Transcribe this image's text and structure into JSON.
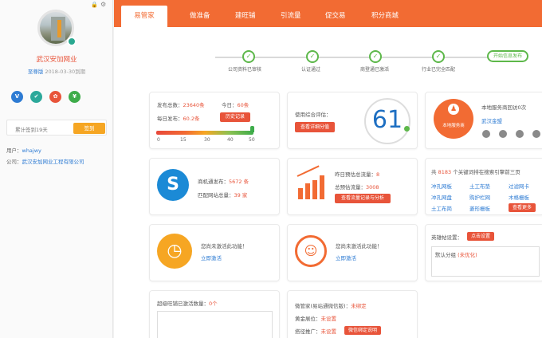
{
  "sidebar": {
    "company_name": "武汉安加网业",
    "level": "至尊版",
    "expire": "2018-03-30到期",
    "badges": [
      "V",
      "✔",
      "✿",
      "¥"
    ],
    "signin_text": "累计签到19天",
    "signin_button": "签到",
    "user_label": "用户：",
    "user_value": "whajwy",
    "company_label": "公司：",
    "company_value": "武汉安加网业工程有限公司"
  },
  "tabs": [
    "易管家",
    "做准备",
    "建旺铺",
    "引流量",
    "促交易",
    "积分商城"
  ],
  "steps": [
    "公司资料已审核",
    "认证通过",
    "商登通已激活",
    "行业已完全匹配",
    "开始信息发布"
  ],
  "stats": {
    "publish_total_label": "发布总数：",
    "publish_total": "23640条",
    "today_label": "今日：",
    "today": "60条",
    "daily_label": "每日发布：",
    "daily": "60.2条",
    "history_button": "历史记录",
    "scale": [
      "0",
      "15",
      "30",
      "40",
      "50"
    ],
    "score_value": 50
  },
  "evaluation": {
    "label": "使用综合评估：",
    "button": "查看详细分值",
    "score": "61"
  },
  "service": {
    "text": "本地服务商回访0次",
    "badge": "本地服务商",
    "link": "武汉金盟"
  },
  "business": {
    "label1": "商机通发布：",
    "val1": "5672 条",
    "label2": "匹配网站总量：",
    "val2": "39 家"
  },
  "traffic": {
    "label1": "昨日预估总流量：",
    "val1": "8",
    "label2": "总预估流量：",
    "val2": "3008",
    "button": "查看流量记录与分析"
  },
  "keywords": {
    "prefix": "共",
    "count": "8183",
    "suffix": "个关键词排在搜索引擎前三页",
    "items": [
      "冲孔网板",
      "土工布垫",
      "过滤网卡",
      "冲孔网盘",
      "购护栏网",
      "木格栅板",
      "土工布简",
      "菱形栅板"
    ],
    "more_button": "查看更多"
  },
  "activate1": {
    "text": "您尚未激活此功能！",
    "link": "立即激活"
  },
  "activate2": {
    "text": "您尚未激活此功能！",
    "link": "立即激活"
  },
  "settings": {
    "label": "英雄帖设置：",
    "button": "点击设置",
    "group_prefix": "默认分组",
    "group_status": "(未优化)"
  },
  "wangpu": {
    "label": "超级旺铺已激活数量：",
    "count": "0个"
  },
  "weiguanjia": {
    "label1": "微管家(易站通微信版)：",
    "val1": "未绑定",
    "label2": "黄金展位：",
    "val2": "未设置",
    "label3": "搭径推广：",
    "val3": "未设置",
    "button": "微信绑定说明"
  }
}
